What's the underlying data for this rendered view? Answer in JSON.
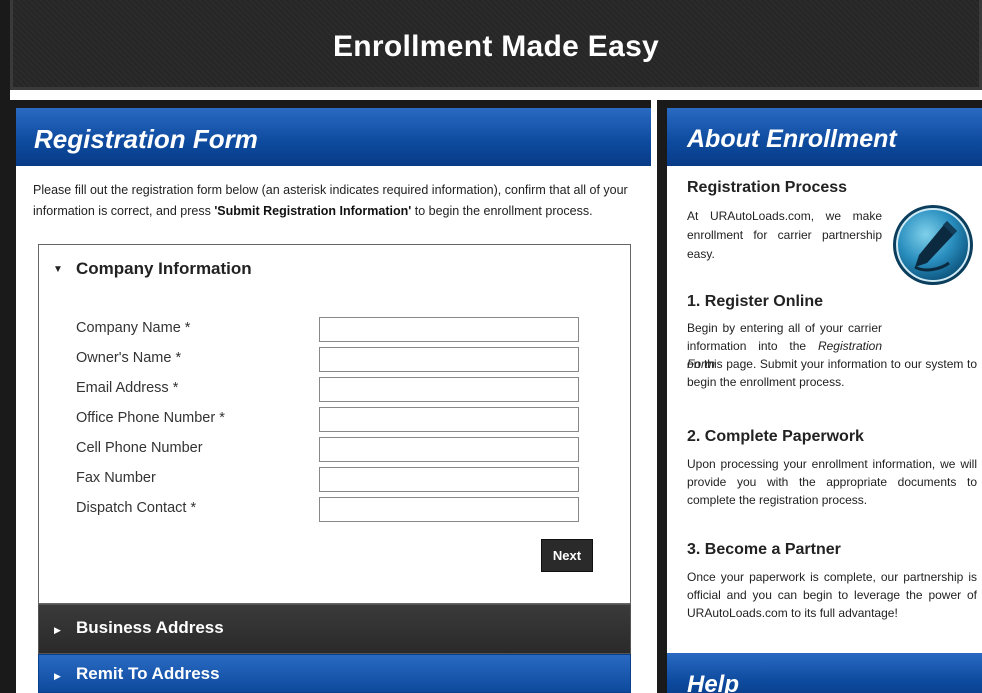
{
  "header": {
    "title": "Enrollment Made Easy"
  },
  "registration": {
    "title": "Registration Form",
    "intro_prefix": "Please fill out the registration form below (an asterisk indicates required information), confirm that all of your information is correct, and press ",
    "intro_bold": "'Submit Registration Information'",
    "intro_suffix": " to begin the enrollment process.",
    "sections": {
      "company": {
        "label": "Company Information",
        "caret": "▼",
        "fields": [
          {
            "label": "Company Name *",
            "value": ""
          },
          {
            "label": "Owner's Name *",
            "value": ""
          },
          {
            "label": "Email Address *",
            "value": ""
          },
          {
            "label": "Office Phone Number *",
            "value": ""
          },
          {
            "label": "Cell Phone Number",
            "value": ""
          },
          {
            "label": "Fax Number",
            "value": ""
          },
          {
            "label": "Dispatch Contact *",
            "value": ""
          }
        ],
        "next_label": "Next"
      },
      "business": {
        "label": "Business Address",
        "caret": "▶"
      },
      "remit": {
        "label": "Remit To Address",
        "caret": "▶"
      }
    }
  },
  "about": {
    "title": "About Enrollment",
    "icon": "pen-icon",
    "sections": [
      {
        "heading": "Registration Process",
        "text": "At URAutoLoads.com, we make enrollment for carrier partnership easy."
      },
      {
        "heading": "1. Register Online",
        "text_prefix": "Begin by entering all of your carrier information into the ",
        "text_italic": "Registration Form",
        "text_suffix": " on this page. Submit your information to our system to begin the enrollment process."
      },
      {
        "heading": "2. Complete Paperwork",
        "text": "Upon processing your enrollment information, we will provide you with the appropriate documents to complete the registration process."
      },
      {
        "heading": "3. Become a Partner",
        "text": "Once your paperwork is complete, our partnership is official and you can begin to leverage the power of URAutoLoads.com to its full advantage!"
      }
    ]
  },
  "help": {
    "title": "Help"
  },
  "colors": {
    "accent_blue": "#0d4a9e",
    "dark": "#2a2a2a"
  }
}
